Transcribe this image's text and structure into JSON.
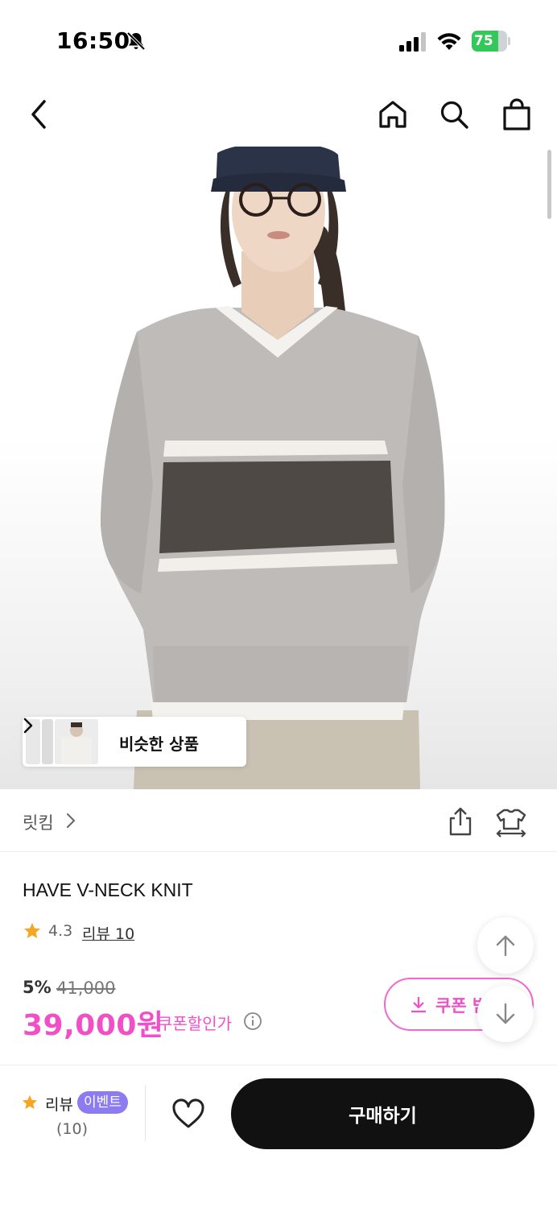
{
  "status_bar": {
    "time": "16:50",
    "battery": "75",
    "battery_level": 0.75,
    "icons": [
      "bell-slash-icon",
      "cellular-signal-icon",
      "wifi-icon",
      "battery-charging-icon"
    ]
  },
  "nav": {
    "icons": [
      "chevron-left-icon",
      "home-icon",
      "search-icon",
      "shopping-bag-icon"
    ]
  },
  "hero": {
    "similar_products_label": "비슷한 상품"
  },
  "brand": {
    "name": "릿킴"
  },
  "product": {
    "title": "HAVE V-NECK KNIT",
    "rating": "4.3",
    "review_link": "리뷰 10",
    "discount_rate": "5%",
    "original_price": "41,000",
    "sale_price": "39,000원",
    "coupon_price_label": "쿠폰할인가"
  },
  "coupon_button": {
    "label": "쿠폰 받"
  },
  "bottom_bar": {
    "review_label": "리뷰",
    "event_badge": "이벤트",
    "review_count": "(10)",
    "buy_label": "구매하기"
  },
  "colors": {
    "accent_pink": "#f04fc8",
    "badge_purple": "#8d7bf0",
    "star": "#f5a623",
    "buy_button": "#111111"
  }
}
